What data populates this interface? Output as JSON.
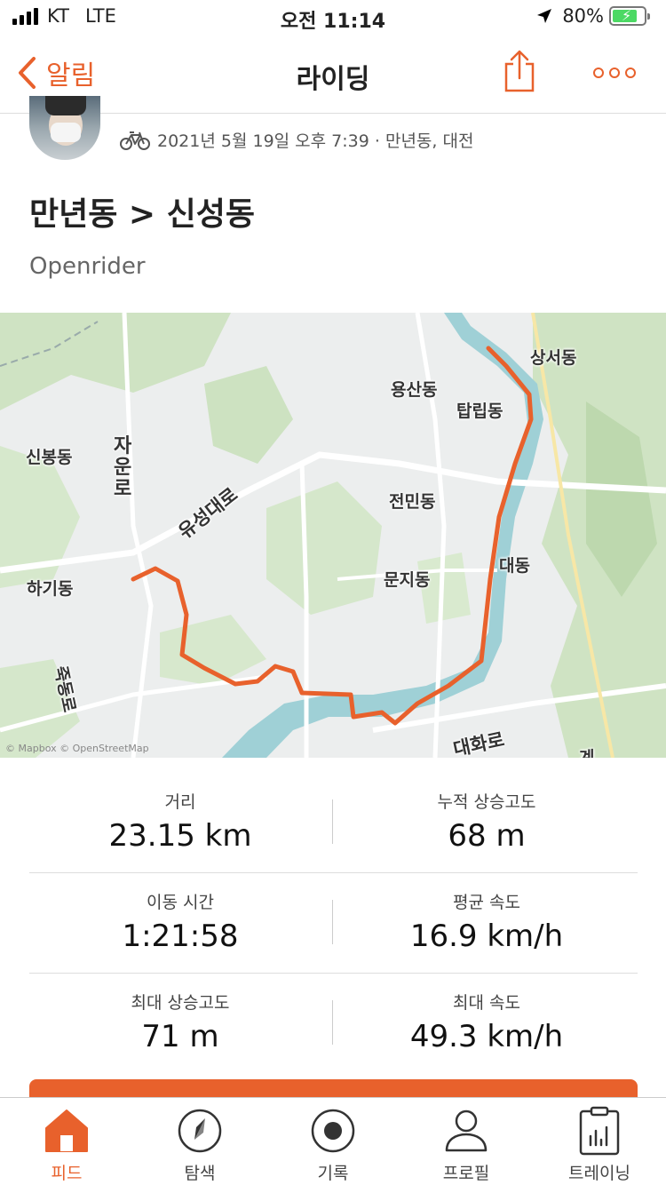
{
  "status_bar": {
    "carrier": "KT",
    "network": "LTE",
    "time": "오전 11:14",
    "battery": "80%",
    "battery_level": 0.8
  },
  "nav": {
    "back_label": "알림",
    "title": "라이딩"
  },
  "activity": {
    "meta": "2021년 5월 19일 오후 7:39 · 만년동, 대전",
    "title": "만년동 > 신성동",
    "device": "Openrider"
  },
  "map": {
    "labels": [
      "상서동",
      "용산동",
      "탑립동",
      "신봉동",
      "자",
      "운",
      "로",
      "유성대로",
      "전민동",
      "하기동",
      "문지동",
      "대동",
      "죽동로",
      "대화로",
      "계"
    ],
    "attribution": "© Mapbox © OpenStreetMap",
    "route_color": "#e8612c"
  },
  "stats": [
    {
      "left": {
        "label": "거리",
        "value": "23.15 km"
      },
      "right": {
        "label": "누적 상승고도",
        "value": "68 m"
      }
    },
    {
      "left": {
        "label": "이동 시간",
        "value": "1:21:58"
      },
      "right": {
        "label": "평균 속도",
        "value": "16.9 km/h"
      }
    },
    {
      "left": {
        "label": "최대 상승고도",
        "value": "71 m"
      },
      "right": {
        "label": "최대 속도",
        "value": "49.3 km/h"
      }
    }
  ],
  "tabs": [
    {
      "label": "피드",
      "icon": "home-icon",
      "active": true
    },
    {
      "label": "탐색",
      "icon": "compass-icon",
      "active": false
    },
    {
      "label": "기록",
      "icon": "record-icon",
      "active": false
    },
    {
      "label": "프로필",
      "icon": "profile-icon",
      "active": false
    },
    {
      "label": "트레이닝",
      "icon": "training-icon",
      "active": false
    }
  ],
  "colors": {
    "accent": "#e8612c",
    "battery": "#4cd964"
  }
}
